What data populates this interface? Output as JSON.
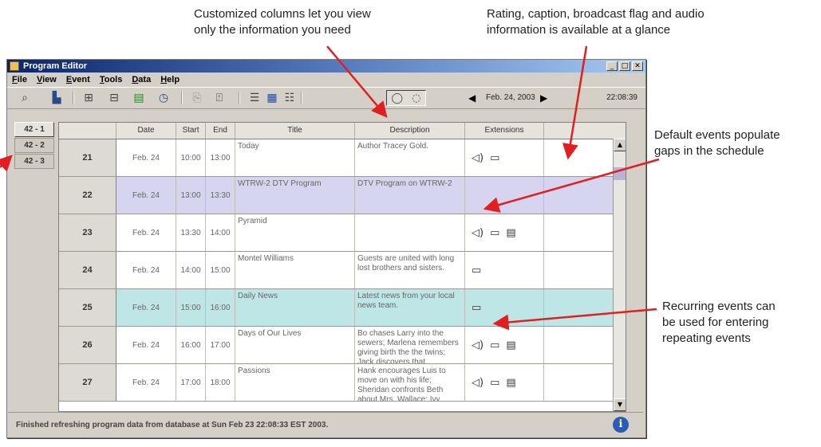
{
  "callouts": {
    "columns": "Customized columns let you view\nonly the information you need",
    "rating": "Rating, caption, broadcast flag and audio\ninformation is available at a glance",
    "default_events": "Default events populate\ngaps in the schedule",
    "recurring": "Recurring events can\nbe used for entering\nrepeating events"
  },
  "window": {
    "title": "Program Editor",
    "controls": {
      "minimize": "_",
      "maximize": "□",
      "close": "✕"
    }
  },
  "menu": [
    "File",
    "View",
    "Event",
    "Tools",
    "Data",
    "Help"
  ],
  "toolbar": {
    "date": "Feb. 24, 2003",
    "time": "22:08:39",
    "prev": "◀",
    "next": "▶",
    "icons": [
      "search-icon",
      "trash-icon",
      "insert-event-icon",
      "delete-event-icon",
      "save-icon",
      "clock-icon",
      "copy-icon",
      "export-icon",
      "grid-view-1-icon",
      "grid-view-2-icon",
      "grid-view-3-icon",
      "caption-bubble-icon",
      "rating-bubble-icon"
    ]
  },
  "channels": [
    "42 - 1",
    "42 - 2",
    "42 - 3"
  ],
  "table": {
    "headers": [
      "",
      "Date",
      "Start",
      "End",
      "Title",
      "Description",
      "Extensions"
    ],
    "rows": [
      {
        "num": "21",
        "date": "Feb. 24",
        "start": "10:00",
        "end": "13:00",
        "title": "Today",
        "description": "Author Tracey Gold.",
        "type": "normal",
        "ext": [
          "audio-icon",
          "caption-icon"
        ]
      },
      {
        "num": "22",
        "date": "Feb. 24",
        "start": "13:00",
        "end": "13:30",
        "title": "WTRW-2 DTV Program",
        "description": "DTV Program on WTRW-2",
        "type": "default",
        "ext": []
      },
      {
        "num": "23",
        "date": "Feb. 24",
        "start": "13:30",
        "end": "14:00",
        "title": "Pyramid",
        "description": "",
        "type": "normal",
        "ext": [
          "audio-icon",
          "caption-icon",
          "rating-icon"
        ]
      },
      {
        "num": "24",
        "date": "Feb. 24",
        "start": "14:00",
        "end": "15:00",
        "title": "Montel Williams",
        "description": "Guests are united with long lost brothers and sisters.",
        "type": "normal",
        "ext": [
          "caption-icon"
        ]
      },
      {
        "num": "25",
        "date": "Feb. 24",
        "start": "15:00",
        "end": "16:00",
        "title": "Daily News",
        "description": "Latest news from your local news team.",
        "type": "recurring",
        "ext": [
          "caption-icon"
        ]
      },
      {
        "num": "26",
        "date": "Feb. 24",
        "start": "16:00",
        "end": "17:00",
        "title": "Days of Our Lives",
        "description": "Bo chases Larry into the sewers; Marlena remembers giving birth the the twins; Jack discovers that",
        "type": "normal",
        "ext": [
          "audio-icon",
          "caption-icon",
          "rating-icon"
        ]
      },
      {
        "num": "27",
        "date": "Feb. 24",
        "start": "17:00",
        "end": "18:00",
        "title": "Passions",
        "description": "Hank encourages Luis to move on with his life; Sheridan confronts Beth about Mrs. Wallace; Ivy",
        "type": "normal",
        "ext": [
          "audio-icon",
          "caption-icon",
          "rating-icon"
        ]
      }
    ]
  },
  "status": {
    "text": "Finished refreshing program data from database at Sun Feb 23 22:08:33 EST 2003.",
    "info_symbol": "i"
  },
  "colors": {
    "default_row": "#d6d4ee",
    "recurring_row": "#bfe6e6",
    "arrow": "#e02020",
    "title_bar": "#0a246a"
  }
}
